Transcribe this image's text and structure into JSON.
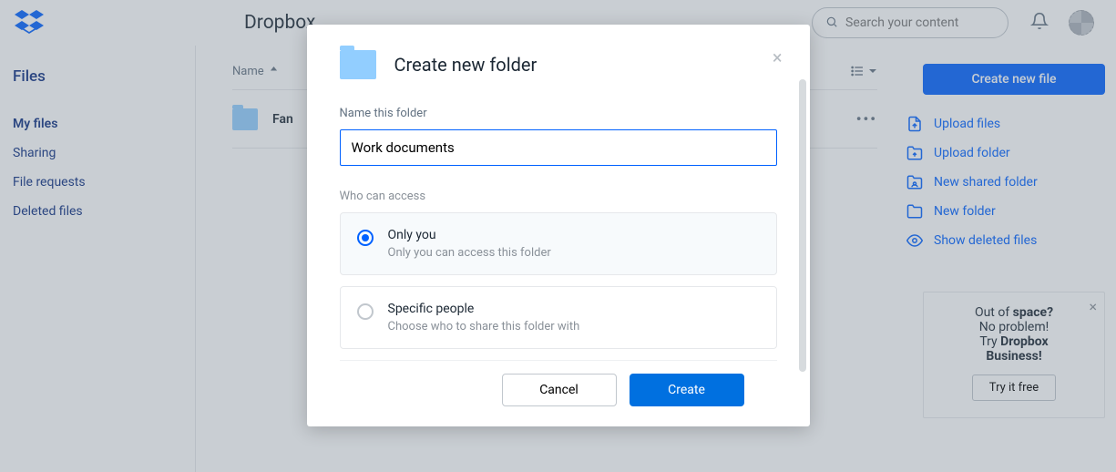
{
  "header": {
    "title": "Dropbox",
    "search_placeholder": "Search your content"
  },
  "sidebar": {
    "heading": "Files",
    "items": [
      {
        "label": "My files",
        "active": true
      },
      {
        "label": "Sharing"
      },
      {
        "label": "File requests"
      },
      {
        "label": "Deleted files"
      }
    ]
  },
  "list": {
    "columns": {
      "name": "Name"
    },
    "rows": [
      {
        "name": "Fan"
      }
    ],
    "row_actions_glyph": "•••"
  },
  "rail": {
    "primary_button": "Create new file",
    "actions": [
      {
        "label": "Upload files",
        "icon": "upload-file-icon"
      },
      {
        "label": "Upload folder",
        "icon": "upload-folder-icon"
      },
      {
        "label": "New shared folder",
        "icon": "shared-folder-icon"
      },
      {
        "label": "New folder",
        "icon": "new-folder-icon"
      },
      {
        "label": "Show deleted files",
        "icon": "show-deleted-icon"
      }
    ],
    "promo": {
      "line1_a": "Out of ",
      "line1_b": "space?",
      "line2": "No problem!",
      "line3_a": "Try ",
      "line3_b": "Dropbox",
      "line4": "Business!",
      "button": "Try it free"
    }
  },
  "modal": {
    "title": "Create new folder",
    "name_label": "Name this folder",
    "name_value": "Work documents",
    "access_label": "Who can access",
    "options": [
      {
        "title": "Only you",
        "sub": "Only you can access this folder"
      },
      {
        "title": "Specific people",
        "sub": "Choose who to share this folder with"
      }
    ],
    "cancel": "Cancel",
    "create": "Create"
  }
}
